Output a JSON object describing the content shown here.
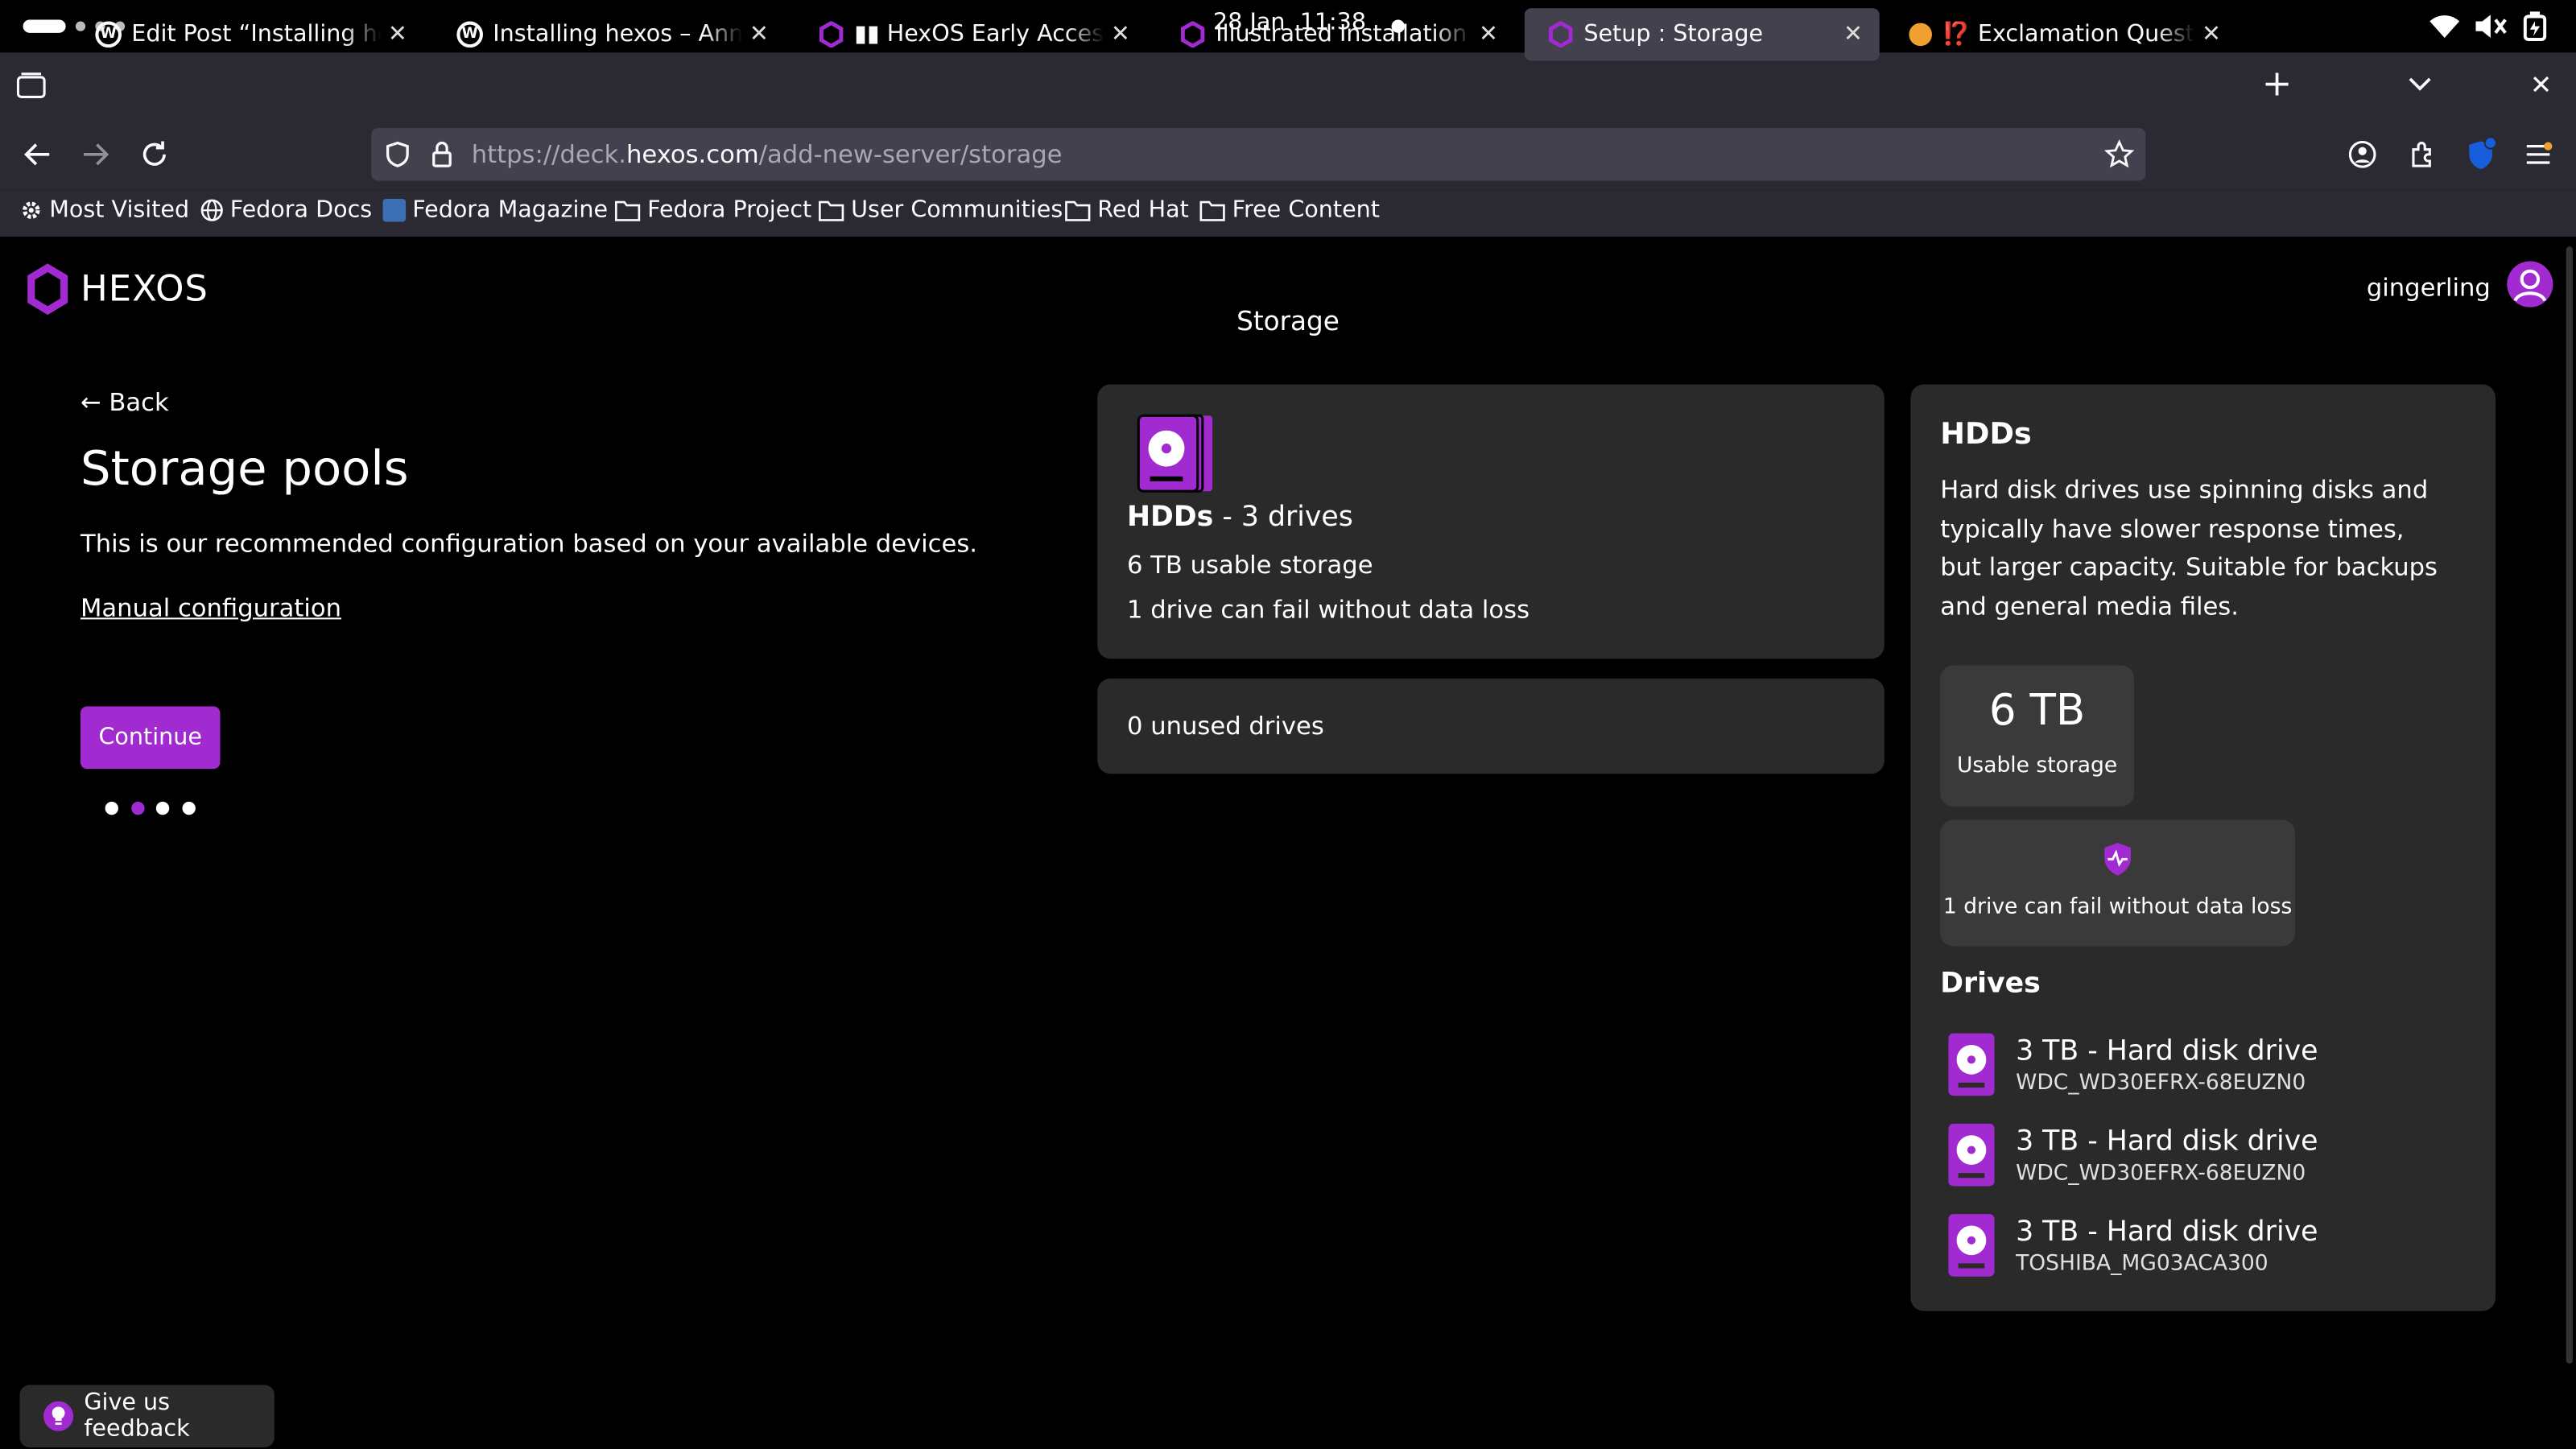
{
  "system": {
    "date": "28 Jan",
    "time": "11:38"
  },
  "tabs": [
    {
      "title": "Edit Post “Installing hexos",
      "icon": "wordpress-icon"
    },
    {
      "title": "Installing hexos – Anna F",
      "icon": "wordpress-icon"
    },
    {
      "title": "▮▮ HexOS Early Access Pr",
      "icon": "hexos-icon"
    },
    {
      "title": "Illustrated Installation Gu",
      "icon": "hexos-icon"
    },
    {
      "title": "Setup : Storage",
      "icon": "hexos-icon",
      "active": true
    },
    {
      "title": "⁉️ Exclamation Question",
      "icon": "emoji-icon"
    }
  ],
  "address": {
    "prefix": "https://deck.",
    "domain": "hexos.com",
    "path": "/add-new-server/storage"
  },
  "bookmarks": [
    "Most Visited",
    "Fedora Docs",
    "Fedora Magazine",
    "Fedora Project",
    "User Communities",
    "Red Hat",
    "Free Content"
  ],
  "header": {
    "logo": "HEXOS",
    "page_title": "Storage",
    "username": "gingerling"
  },
  "left": {
    "back_label": "← Back",
    "title": "Storage pools",
    "description": "This is our recommended configuration based on your available devices.",
    "manual_link": "Manual configuration",
    "continue_label": "Continue",
    "step_current": 2,
    "step_total": 4
  },
  "pool_card": {
    "type_label": "HDDs",
    "drives_suffix": " - 3 drives",
    "usable": "6 TB usable storage",
    "fault": "1 drive can fail without data loss"
  },
  "unused": "0 unused drives",
  "details": {
    "title": "HDDs",
    "description": "Hard disk drives use spinning disks and typically have slower response times, but larger capacity. Suitable for backups and general media files.",
    "capacity_value": "6 TB",
    "capacity_label": "Usable storage",
    "fault_label": "1 drive can fail without data loss",
    "drives_heading": "Drives",
    "drives": [
      {
        "name": "3 TB - Hard disk drive",
        "model": "WDC_WD30EFRX-68EUZN0"
      },
      {
        "name": "3 TB - Hard disk drive",
        "model": "WDC_WD30EFRX-68EUZN0"
      },
      {
        "name": "3 TB - Hard disk drive",
        "model": "TOSHIBA_MG03ACA300"
      }
    ]
  },
  "feedback_label": "Give us feedback",
  "colors": {
    "accent": "#a12ad1",
    "card": "#2a2a2a",
    "browser_chrome": "#2b2a33"
  }
}
